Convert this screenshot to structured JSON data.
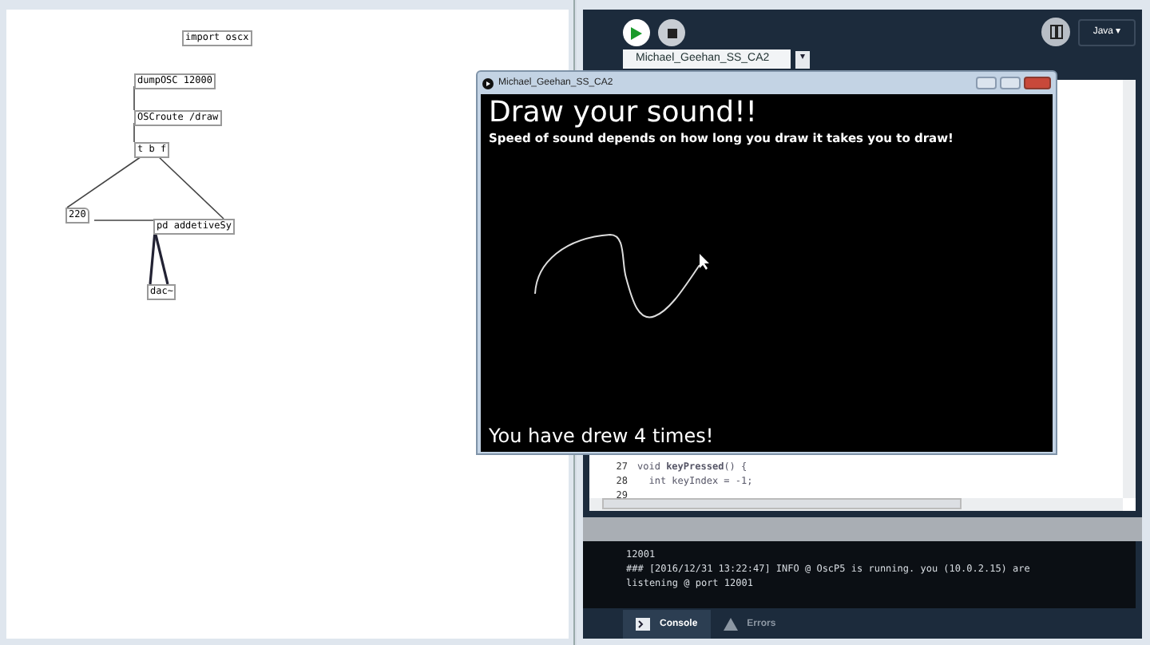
{
  "pd_window": {
    "objects": [
      {
        "kind": "object",
        "text": "import oscx"
      },
      {
        "kind": "object",
        "text": "dumpOSC 12000"
      },
      {
        "kind": "object",
        "text": "OSCroute /draw"
      },
      {
        "kind": "object",
        "text": "t b f"
      },
      {
        "kind": "number",
        "text": "220"
      },
      {
        "kind": "object",
        "text": "pd addetiveSy"
      },
      {
        "kind": "object",
        "text": "dac~"
      }
    ]
  },
  "processing_window": {
    "mode": "Java ▾",
    "tab": "Michael_Geehan_SS_CA2",
    "tab_arrow": "▾",
    "code_lines": [
      {
        "number": "27",
        "code": "void **keyPressed**() {"
      },
      {
        "number": "28",
        "code": "  int keyIndex = -1;"
      },
      {
        "number": "29"
      }
    ],
    "console_lines": [
      "12001",
      "### [2016/12/31 13:22:47] INFO @ OscP5 is running. you (10.0.2.15) are",
      "listening @ port 12001"
    ],
    "bottom_tabs": [
      {
        "label": "Console",
        "selected": true
      },
      {
        "label": "Errors",
        "selected": false
      }
    ]
  },
  "sketch_window": {
    "title": "Michael_Geehan_SS_CA2",
    "heading": "Draw your sound!!",
    "subtitle": "Speed of sound depends on how long you draw it takes you to draw!",
    "footer": "You have drew 4 times!"
  }
}
